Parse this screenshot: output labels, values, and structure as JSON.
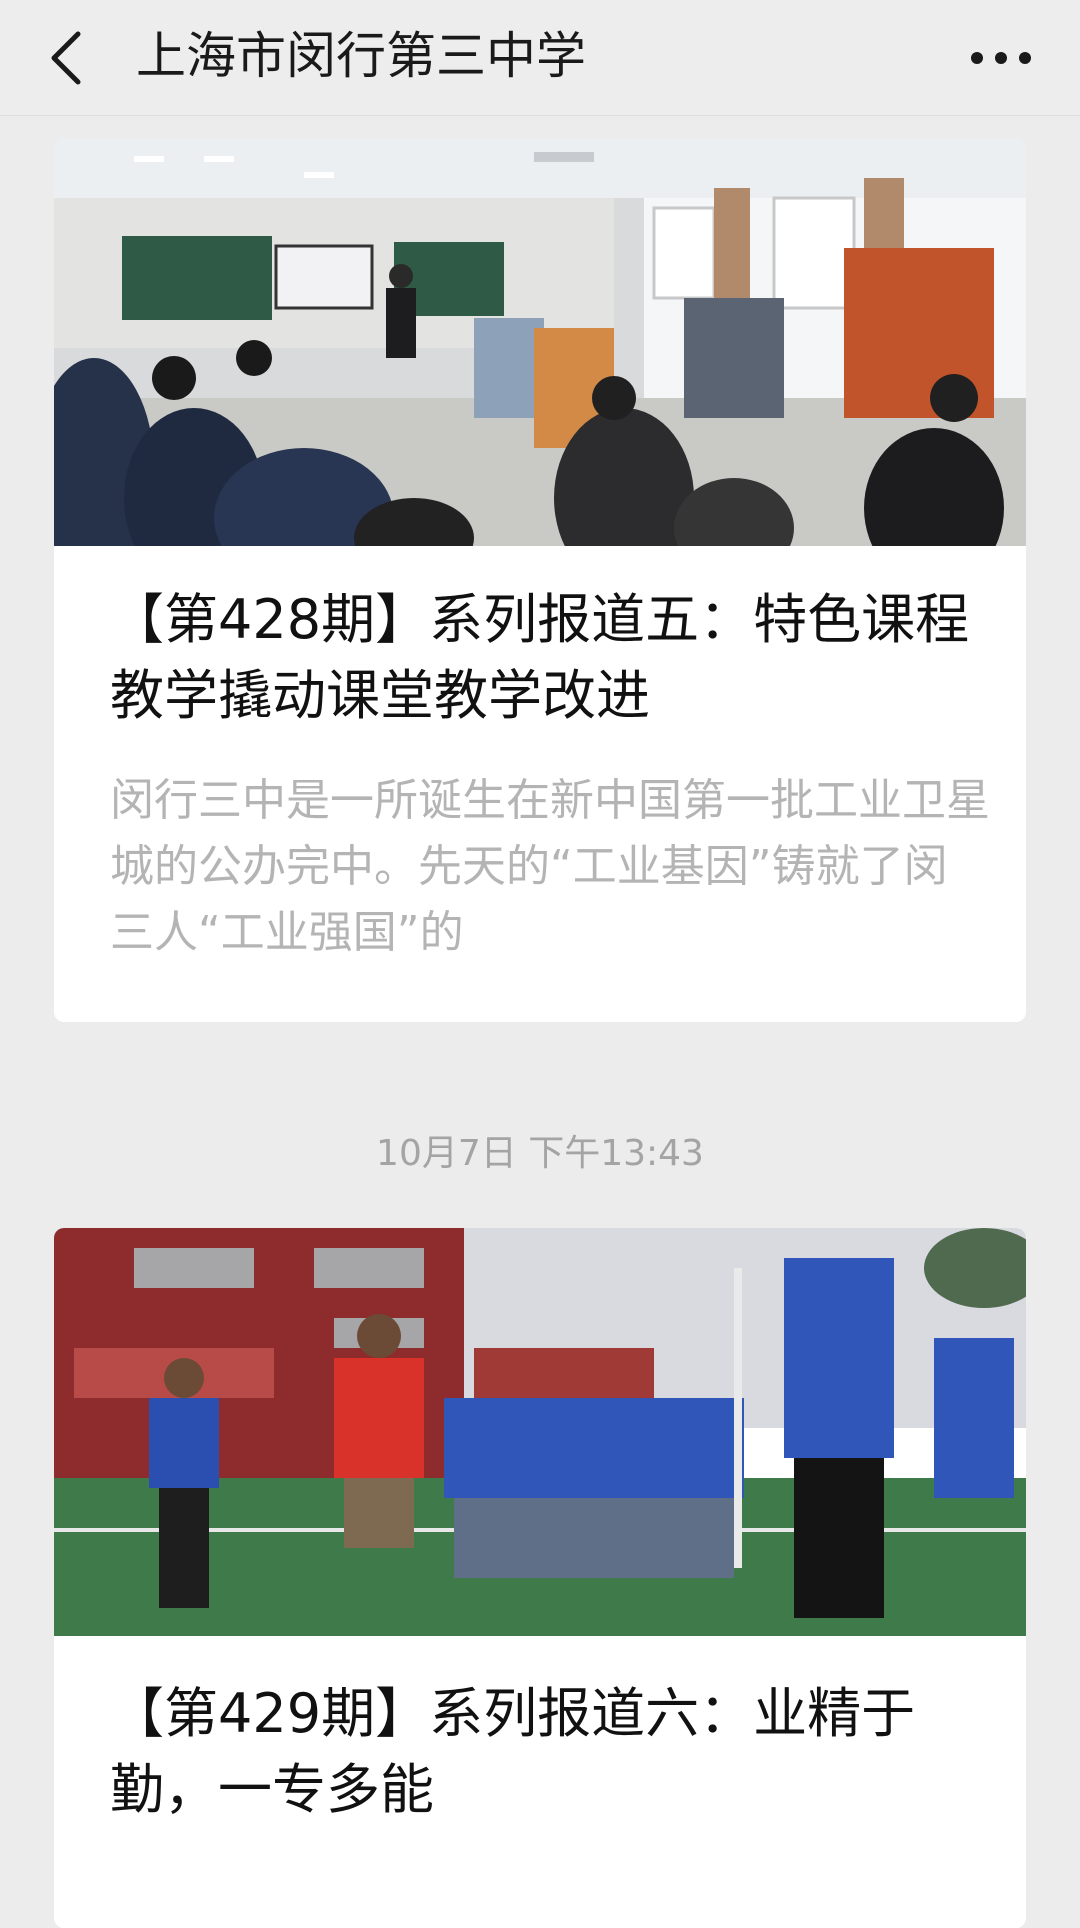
{
  "nav": {
    "back_icon": "back-chevron-icon",
    "title": "上海市闵行第三中学",
    "more_icon": "more-dots-icon"
  },
  "articles": [
    {
      "image": "classroom-photo",
      "title": "【第428期】系列报道五：特色课程教学撬动课堂教学改进",
      "summary": "闵行三中是一所诞生在新中国第一批工业卫星城的公办完中。先天的“工业基因”铸就了闵三人“工业强国”的"
    },
    {
      "image": "sports-field-photo",
      "title": "【第429期】系列报道六：业精于勤，一专多能",
      "summary": ""
    }
  ],
  "timestamp": "10月7日 下午13:43"
}
